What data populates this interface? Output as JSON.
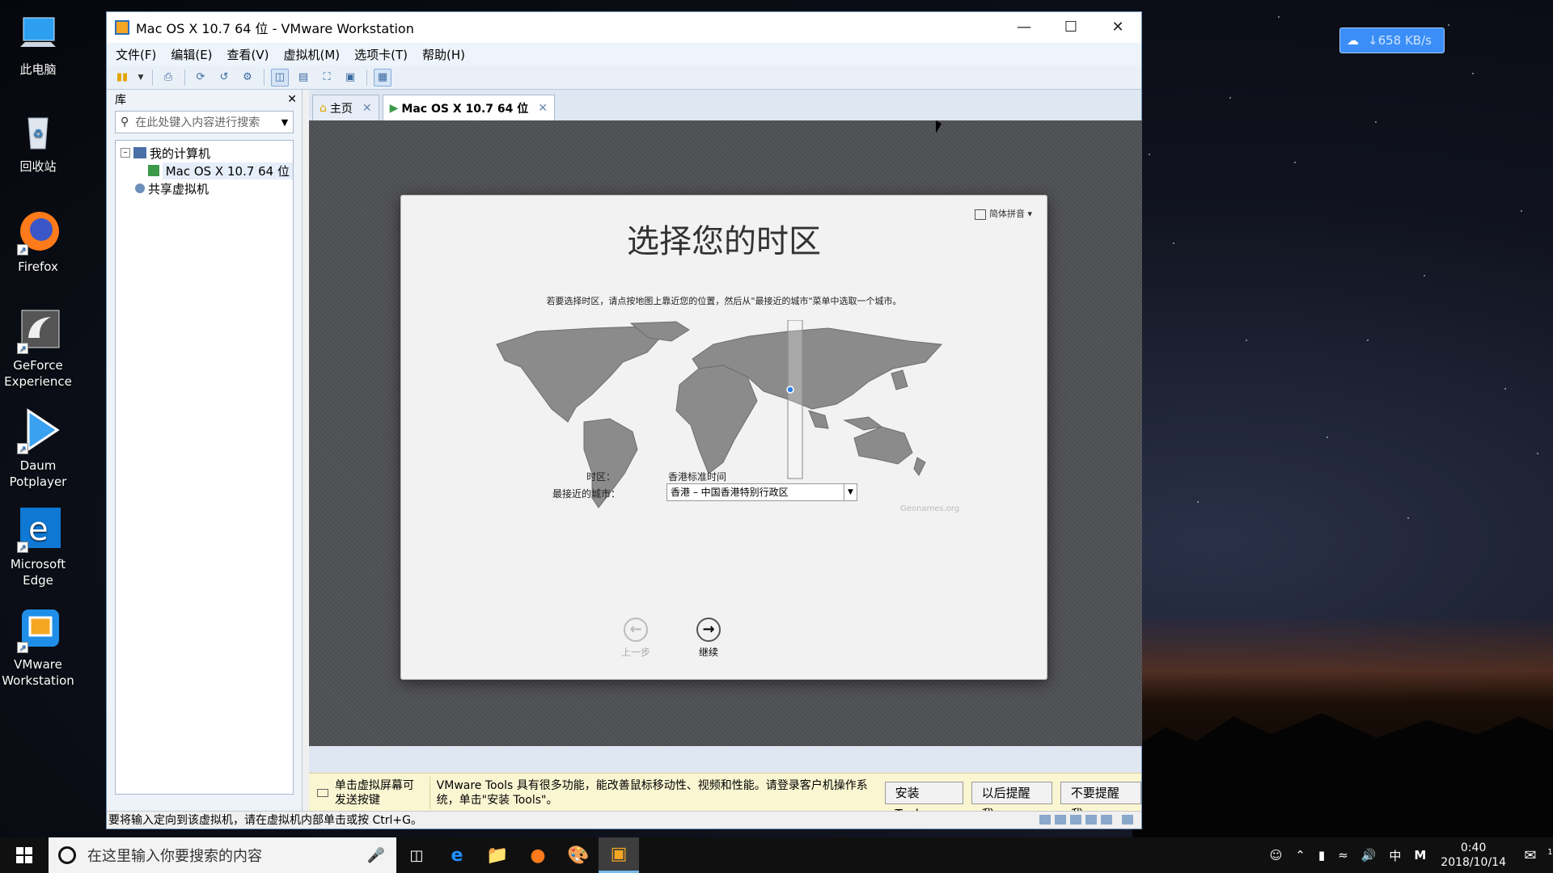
{
  "desktop": {
    "icons": [
      {
        "label": "此电脑",
        "icon": "computer-icon"
      },
      {
        "label": "回收站",
        "icon": "recycle-bin-icon"
      },
      {
        "label": "Firefox",
        "icon": "firefox-icon"
      },
      {
        "label": "GeForce Experience",
        "icon": "geforce-icon"
      },
      {
        "label": "Daum Potplayer",
        "icon": "potplayer-icon"
      },
      {
        "label": "Microsoft Edge",
        "icon": "edge-icon"
      },
      {
        "label": "VMware Workstation",
        "icon": "vmware-icon"
      }
    ],
    "net_speed": "↓658 KB/s"
  },
  "window": {
    "title": "Mac OS X 10.7 64 位 - VMware Workstation",
    "menu": [
      "文件(F)",
      "编辑(E)",
      "查看(V)",
      "虚拟机(M)",
      "选项卡(T)",
      "帮助(H)"
    ],
    "library": {
      "title": "库",
      "search_placeholder": "在此处键入内容进行搜索",
      "tree": {
        "my_computer": "我的计算机",
        "vm_item": "Mac OS X 10.7 64 位",
        "shared": "共享虚拟机"
      }
    },
    "tabs": [
      {
        "label": "主页"
      },
      {
        "label": "Mac OS X 10.7 64 位"
      }
    ],
    "status_text": "要将输入定向到该虚拟机，请在虚拟机内部单击或按 Ctrl+G。"
  },
  "mac_setup": {
    "input_method": "简体拼音",
    "heading": "选择您的时区",
    "instruction": "若要选择时区，请点按地图上靠近您的位置，然后从\"最接近的城市\"菜单中选取一个城市。",
    "credit": "Geonames.org",
    "timezone_label": "时区：",
    "timezone_value": "香港标准时间",
    "city_label": "最接近的城市：",
    "city_value": "香港 – 中国香港特别行政区",
    "back_label": "上一步",
    "continue_label": "继续"
  },
  "tools_banner": {
    "hint": "单击虚拟屏幕可发送按键",
    "message": "VMware Tools 具有很多功能，能改善鼠标移动性、视频和性能。请登录客户机操作系统，单击\"安装 Tools\"。",
    "install": "安装 Tools",
    "remind_later": "以后提醒我",
    "never_remind": "不要提醒我"
  },
  "taskbar": {
    "search_placeholder": "在这里输入你要搜索的内容",
    "ime": "中",
    "ime_mode": "M",
    "time": "0:40",
    "date": "2018/10/14",
    "notifications": "1"
  },
  "colors": {
    "vm_accent": "#3a8ef6",
    "mac_bg": "#f2f2f2",
    "banner_bg": "#fbf6d2",
    "taskbar_bg": "#101010"
  }
}
